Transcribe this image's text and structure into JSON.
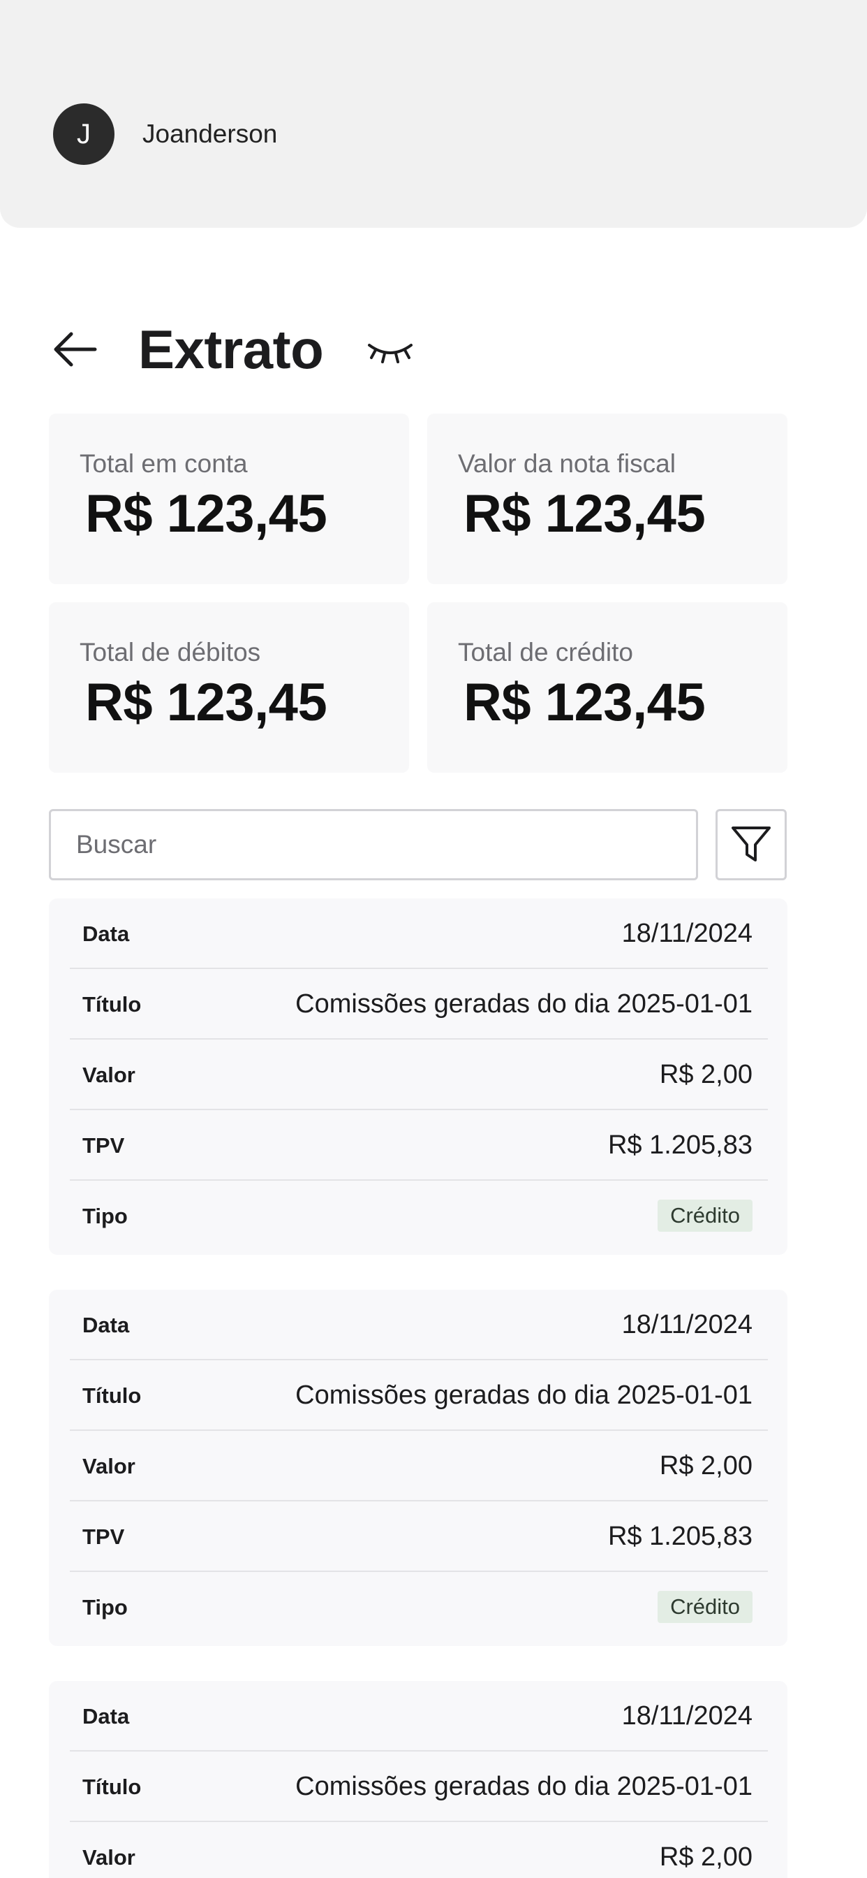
{
  "user": {
    "initial": "J",
    "name": "Joanderson"
  },
  "page": {
    "title": "Extrato"
  },
  "summary": [
    {
      "label": "Total em conta",
      "value": "R$ 123,45"
    },
    {
      "label": "Valor da nota fiscal",
      "value": "R$ 123,45"
    },
    {
      "label": "Total de débitos",
      "value": "R$ 123,45"
    },
    {
      "label": "Total de crédito",
      "value": "R$ 123,45"
    }
  ],
  "search": {
    "placeholder": "Buscar",
    "value": ""
  },
  "icons": {
    "back": "arrow-left-icon",
    "visibility": "eye-closed-icon",
    "filter": "filter-icon"
  },
  "field_labels": {
    "date": "Data",
    "title": "Título",
    "amount": "Valor",
    "tpv": "TPV",
    "type": "Tipo"
  },
  "transactions": [
    {
      "date": "18/11/2024",
      "title": "Comissões geradas do dia 2025-01-01",
      "amount": "R$ 2,00",
      "tpv": "R$ 1.205,83",
      "type": "Crédito"
    },
    {
      "date": "18/11/2024",
      "title": "Comissões geradas do dia 2025-01-01",
      "amount": "R$ 2,00",
      "tpv": "R$ 1.205,83",
      "type": "Crédito"
    },
    {
      "date": "18/11/2024",
      "title": "Comissões geradas do dia 2025-01-01",
      "amount": "R$ 2,00"
    }
  ],
  "colors": {
    "header_bg": "#f1f1f1",
    "card_bg": "#f8f8f9",
    "badge_bg": "#e3ede4",
    "avatar_bg": "#2b2b2b"
  }
}
